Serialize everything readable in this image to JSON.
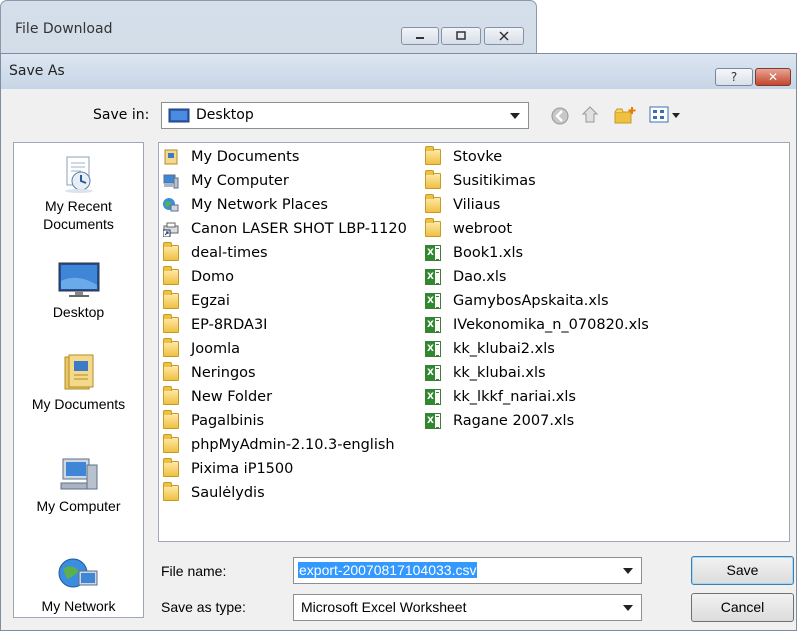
{
  "background_window": {
    "title": "File Download"
  },
  "dialog": {
    "title": "Save As",
    "help_label": "?",
    "close_label": "✕",
    "save_in_label": "Save in:",
    "save_in_value": "Desktop",
    "toolbar_icons": [
      "back-icon",
      "up-folder-icon",
      "new-folder-icon",
      "view-menu-icon"
    ]
  },
  "places": [
    {
      "label_lines": [
        "My Recent",
        "Documents"
      ],
      "icon": "recent-documents-icon"
    },
    {
      "label_lines": [
        "Desktop"
      ],
      "icon": "desktop-icon"
    },
    {
      "label_lines": [
        "My Documents"
      ],
      "icon": "my-documents-icon"
    },
    {
      "label_lines": [
        "My Computer"
      ],
      "icon": "my-computer-icon"
    },
    {
      "label_lines": [
        "My Network"
      ],
      "icon": "my-network-icon"
    }
  ],
  "files": {
    "column1": [
      {
        "name": "My Documents",
        "type": "special-docs"
      },
      {
        "name": "My Computer",
        "type": "special-computer"
      },
      {
        "name": "My Network Places",
        "type": "special-network"
      },
      {
        "name": "Canon LASER SHOT LBP-1120",
        "type": "shortcut"
      },
      {
        "name": "deal-times",
        "type": "folder"
      },
      {
        "name": "Domo",
        "type": "folder"
      },
      {
        "name": "Egzai",
        "type": "folder"
      },
      {
        "name": "EP-8RDA3I",
        "type": "folder"
      },
      {
        "name": "Joomla",
        "type": "folder"
      },
      {
        "name": "Neringos",
        "type": "folder"
      },
      {
        "name": "New Folder",
        "type": "folder"
      },
      {
        "name": "Pagalbinis",
        "type": "folder"
      },
      {
        "name": "phpMyAdmin-2.10.3-english",
        "type": "folder"
      },
      {
        "name": "Pixima iP1500",
        "type": "folder"
      },
      {
        "name": "Saulėlydis",
        "type": "folder"
      }
    ],
    "column2": [
      {
        "name": "Stovke",
        "type": "folder"
      },
      {
        "name": "Susitikimas",
        "type": "folder"
      },
      {
        "name": "Viliaus",
        "type": "folder"
      },
      {
        "name": "webroot",
        "type": "folder"
      },
      {
        "name": "Book1.xls",
        "type": "xls"
      },
      {
        "name": "Dao.xls",
        "type": "xls"
      },
      {
        "name": "GamybosApskaita.xls",
        "type": "xls"
      },
      {
        "name": "IVekonomika_n_070820.xls",
        "type": "xls"
      },
      {
        "name": "kk_klubai2.xls",
        "type": "xls"
      },
      {
        "name": "kk_klubai.xls",
        "type": "xls"
      },
      {
        "name": "kk_lkkf_nariai.xls",
        "type": "xls"
      },
      {
        "name": "Ragane 2007.xls",
        "type": "xls"
      }
    ]
  },
  "form": {
    "file_name_label": "File name:",
    "file_name_value": "export-20070817104033.csv",
    "save_as_type_label": "Save as type:",
    "save_as_type_value": "Microsoft Excel Worksheet",
    "save_button": "Save",
    "cancel_button": "Cancel"
  },
  "colors": {
    "selection": "#3399ff",
    "title_bar": "#c6d5e6",
    "close_button": "#c4452c"
  }
}
